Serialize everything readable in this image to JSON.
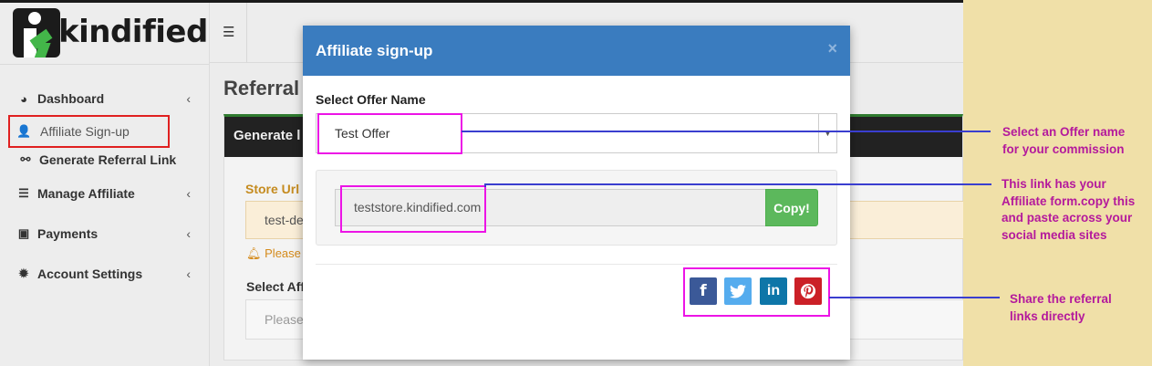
{
  "app": {
    "brand": "kindified",
    "menu_icon": "hamburger-icon",
    "page_title": "Referral",
    "sidebar": [
      {
        "label": "Dashboard",
        "icon": "dashboard-icon",
        "chevron": "‹"
      },
      {
        "label": "Affiliate Sign-up",
        "icon": "user-plus-icon"
      },
      {
        "label": "Generate Referral Link",
        "icon": "link-icon"
      },
      {
        "label": "Manage Affiliate",
        "icon": "list-icon",
        "chevron": "‹"
      },
      {
        "label": "Payments",
        "icon": "money-icon",
        "chevron": "‹"
      },
      {
        "label": "Account Settings",
        "icon": "gear-icon",
        "chevron": "‹"
      }
    ],
    "panel_title": "Generate l",
    "store_url_label": "Store Url",
    "store_url_value": "test-de",
    "warning_text": "Please",
    "select_affiliate_label": "Select Affi",
    "select_affiliate_placeholder": "Please"
  },
  "modal": {
    "title": "Affiliate sign-up",
    "close_symbol": "×",
    "select_label": "Select Offer Name",
    "selected_offer": "Test Offer",
    "link_value": "teststore.kindified.com",
    "copy_label": "Copy!",
    "share_buttons": [
      {
        "name": "facebook",
        "glyph": "f",
        "color": "#3b5998"
      },
      {
        "name": "twitter",
        "glyph": "🐦",
        "color": "#55acee"
      },
      {
        "name": "linkedin",
        "glyph": "in",
        "color": "#0e76a8"
      },
      {
        "name": "pinterest",
        "glyph": "P",
        "color": "#cb2027"
      }
    ]
  },
  "annotations": {
    "offer": "Select an Offer name for your commission",
    "link": "This link has your Affiliate form.copy this and paste across your social media sites",
    "share": "Share the referral links directly"
  },
  "colors": {
    "highlight_magenta": "#ec14e6",
    "highlight_red": "#e02020",
    "annotation_text": "#b4199c",
    "pointer_line": "#3a3ecf",
    "annotation_bg": "#f0e0a8",
    "modal_header": "#3a7cbf"
  }
}
